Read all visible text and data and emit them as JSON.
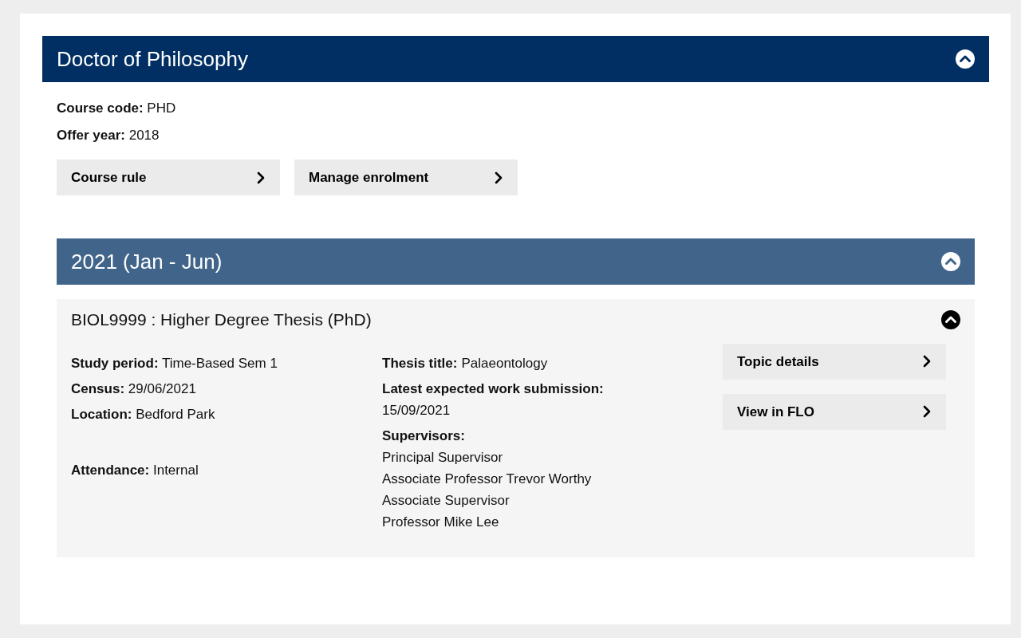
{
  "course": {
    "title": "Doctor of Philosophy",
    "expanded": true,
    "fields": [
      "**Course code:** PHD",
      "**Offer year:** 2018"
    ],
    "buttons": [
      "Course rule",
      "Manage enrolment"
    ],
    "terms": [
      {
        "title": "2021 (Jan - Jun)",
        "expanded": true,
        "topics": [
          {
            "title": "BIOL9999 : Higher Degree Thesis (PhD)",
            "expanded": true,
            "left_fields": [
              "**Study period:** Time-Based Sem 1",
              "**Census:** 29/06/2021",
              "**Location:** Bedford Park",
              "**Attendance:** Internal"
            ],
            "middle_fields": [
              {
                "kind": "inline",
                "label": "Thesis title:",
                "values": [
                  "Palaeontology"
                ]
              },
              {
                "kind": "block",
                "label": "Latest expected work submission:",
                "values": [
                  "15/09/2021"
                ]
              },
              {
                "kind": "block",
                "label": "Supervisors:",
                "values": [
                  "Principal Supervisor",
                  "Associate Professor Trevor Worthy",
                  "Associate Supervisor",
                  "Professor Mike Lee"
                ]
              }
            ],
            "buttons": [
              "Topic details",
              "View in FLO"
            ]
          }
        ]
      }
    ]
  }
}
